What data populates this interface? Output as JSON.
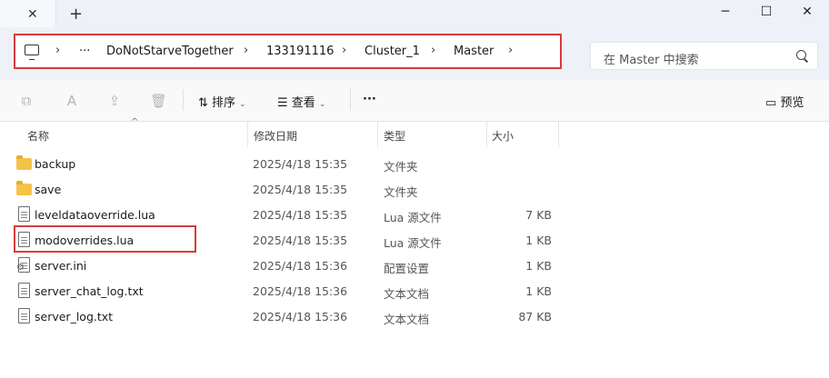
{
  "window": {
    "tab_close": "✕",
    "new_tab": "+",
    "minimize": "─",
    "maximize": "☐",
    "close": "✕"
  },
  "address": {
    "more": "···",
    "separator": "›",
    "crumbs": [
      "DoNotStarveTogether",
      "133191116",
      "Cluster_1",
      "Master"
    ]
  },
  "search": {
    "placeholder": "在 Master 中搜索"
  },
  "toolbar": {
    "sort_label": "排序",
    "view_label": "查看",
    "more_label": "···",
    "preview_label": "预览"
  },
  "columns": {
    "name": "名称",
    "date": "修改日期",
    "type": "类型",
    "size": "大小"
  },
  "files": [
    {
      "name": "backup",
      "date": "2025/4/18 15:35",
      "type": "文件夹",
      "size": "",
      "icon": "folder-icon"
    },
    {
      "name": "save",
      "date": "2025/4/18 15:35",
      "type": "文件夹",
      "size": "",
      "icon": "folder-icon"
    },
    {
      "name": "leveldataoverride.lua",
      "date": "2025/4/18 15:35",
      "type": "Lua 源文件",
      "size": "7 KB",
      "icon": "file-icon"
    },
    {
      "name": "modoverrides.lua",
      "date": "2025/4/18 15:35",
      "type": "Lua 源文件",
      "size": "1 KB",
      "icon": "file-icon"
    },
    {
      "name": "server.ini",
      "date": "2025/4/18 15:36",
      "type": "配置设置",
      "size": "1 KB",
      "icon": "settings-file-icon"
    },
    {
      "name": "server_chat_log.txt",
      "date": "2025/4/18 15:36",
      "type": "文本文档",
      "size": "1 KB",
      "icon": "file-icon"
    },
    {
      "name": "server_log.txt",
      "date": "2025/4/18 15:36",
      "type": "文本文档",
      "size": "87 KB",
      "icon": "file-icon"
    }
  ],
  "colors": {
    "highlight": "#d83b3b",
    "folder": "#f4c34a"
  }
}
